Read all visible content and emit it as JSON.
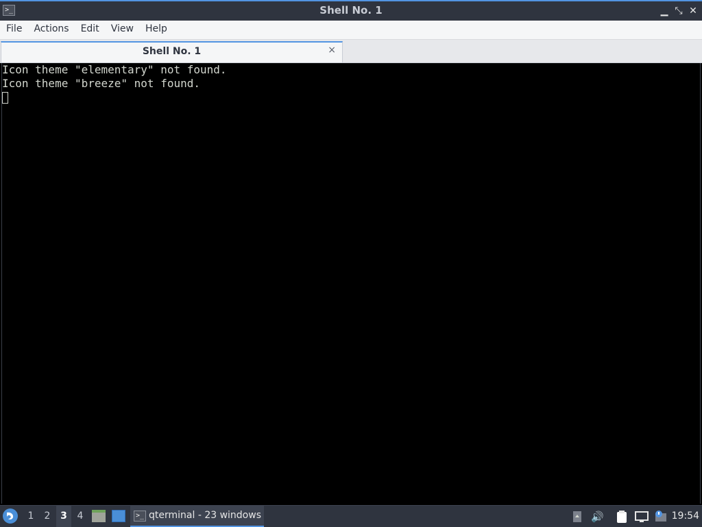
{
  "window": {
    "title": "Shell No. 1",
    "app_icon": "terminal-icon",
    "controls": {
      "minimize": "minimize-icon",
      "maximize": "maximize-icon",
      "close": "close-icon"
    }
  },
  "menubar": {
    "items": [
      {
        "label": "File"
      },
      {
        "label": "Actions"
      },
      {
        "label": "Edit"
      },
      {
        "label": "View"
      },
      {
        "label": "Help"
      }
    ]
  },
  "tabs": [
    {
      "label": "Shell No. 1",
      "close_symbol": "×"
    }
  ],
  "terminal": {
    "lines": [
      "Icon theme \"elementary\" not found.",
      "Icon theme \"breeze\" not found."
    ]
  },
  "taskbar": {
    "start_icon": "lxqt-start-icon",
    "workspaces": [
      "1",
      "2",
      "3",
      "4"
    ],
    "active_workspace": "3",
    "quick_launch": [
      "file-manager-icon",
      "show-desktop-icon"
    ],
    "task": {
      "label": "qterminal - 23 windows",
      "icon": "terminal-icon"
    },
    "tray": [
      "battery-up-icon",
      "volume-icon",
      "clipboard-icon",
      "network-icon",
      "update-notifier-icon"
    ],
    "clock": "19:54"
  },
  "colors": {
    "accent": "#5294e2",
    "titlebar": "#2f343f",
    "terminal_bg": "#000000",
    "terminal_fg": "#d3d7cf"
  }
}
